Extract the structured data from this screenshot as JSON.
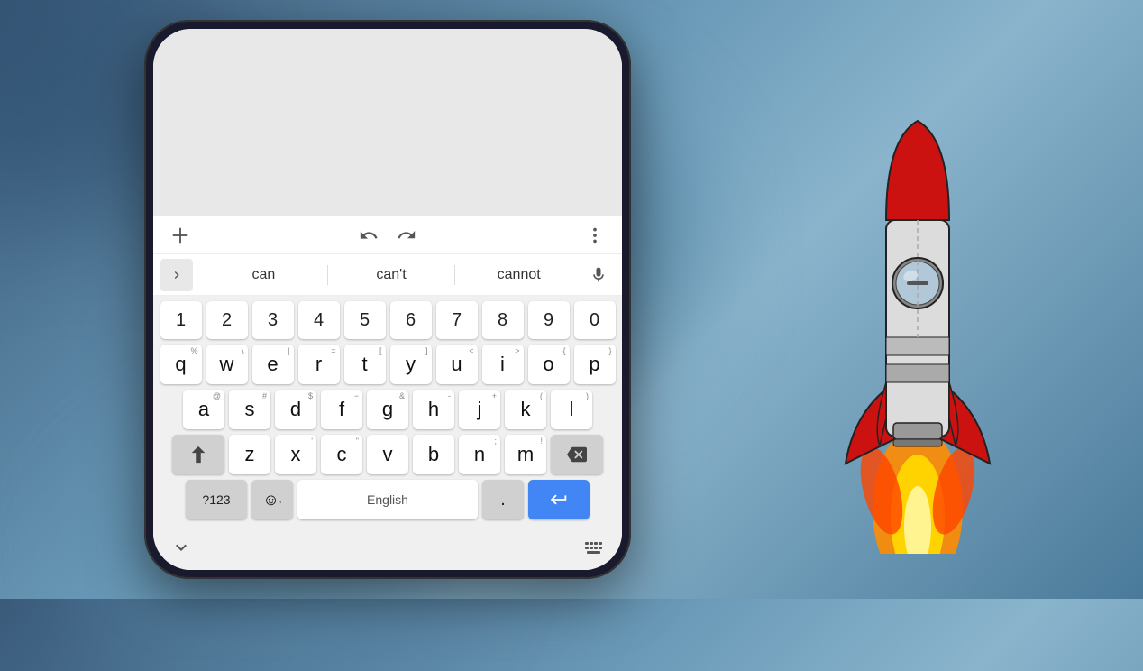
{
  "background": {
    "color_start": "#3a5a7a",
    "color_end": "#6a9ab8"
  },
  "toolbar": {
    "add_icon": "plus-icon",
    "undo_icon": "undo-icon",
    "redo_icon": "redo-icon",
    "more_icon": "more-icon"
  },
  "suggestions": {
    "expand_label": ">",
    "item1": "can",
    "item2": "can't",
    "item3": "cannot",
    "mic_icon": "mic-icon"
  },
  "keyboard": {
    "numbers": [
      "1",
      "2",
      "3",
      "4",
      "5",
      "6",
      "7",
      "8",
      "9",
      "0"
    ],
    "row1": [
      {
        "key": "q",
        "super": "%"
      },
      {
        "key": "w",
        "super": "\\"
      },
      {
        "key": "e",
        "super": "|"
      },
      {
        "key": "r",
        "super": "="
      },
      {
        "key": "t",
        "super": "["
      },
      {
        "key": "y",
        "super": "]"
      },
      {
        "key": "u",
        "super": "<"
      },
      {
        "key": "i",
        "super": ">"
      },
      {
        "key": "o",
        "super": "{"
      },
      {
        "key": "p",
        "super": "}"
      }
    ],
    "row2": [
      {
        "key": "a",
        "super": "@"
      },
      {
        "key": "s",
        "super": "#"
      },
      {
        "key": "d",
        "super": "$"
      },
      {
        "key": "f",
        "super": "−"
      },
      {
        "key": "g",
        "super": "&"
      },
      {
        "key": "h",
        "super": "-"
      },
      {
        "key": "j",
        "super": "+"
      },
      {
        "key": "k",
        "super": "("
      },
      {
        "key": "l",
        "super": ")"
      }
    ],
    "row3_letters": [
      {
        "key": "z",
        "super": ""
      },
      {
        "key": "x",
        "super": "'"
      },
      {
        "key": "c",
        "super": "\""
      },
      {
        "key": "v",
        "super": ""
      },
      {
        "key": "b",
        "super": ""
      },
      {
        "key": "n",
        "super": ";"
      },
      {
        "key": "m",
        "super": "!"
      }
    ],
    "bottom": {
      "num_label": "?123",
      "emoji_symbol": "☺",
      "comma": ",",
      "space_label": "English",
      "period": ".",
      "enter_icon": "enter-icon"
    }
  },
  "footer": {
    "collapse_icon": "chevron-down-icon",
    "keyboard_icon": "keyboard-layout-icon"
  }
}
